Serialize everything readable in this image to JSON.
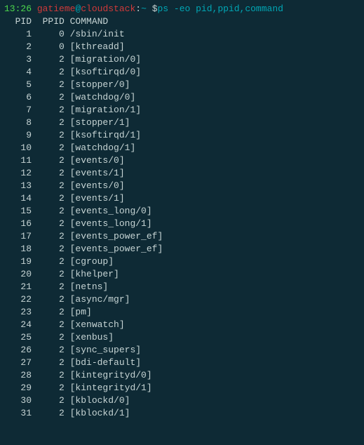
{
  "prompt": {
    "time": "13:26",
    "user": "gatieme",
    "at": "@",
    "host": "cloudstack",
    "colon": ":",
    "path": "~",
    "dollar": " $",
    "command": "ps -eo pid,ppid,command"
  },
  "header": {
    "pid": "  PID",
    "ppid": "  PPID",
    "command": " COMMAND"
  },
  "rows": [
    {
      "pid": "1",
      "ppid": "0",
      "command": "/sbin/init"
    },
    {
      "pid": "2",
      "ppid": "0",
      "command": "[kthreadd]"
    },
    {
      "pid": "3",
      "ppid": "2",
      "command": "[migration/0]"
    },
    {
      "pid": "4",
      "ppid": "2",
      "command": "[ksoftirqd/0]"
    },
    {
      "pid": "5",
      "ppid": "2",
      "command": "[stopper/0]"
    },
    {
      "pid": "6",
      "ppid": "2",
      "command": "[watchdog/0]"
    },
    {
      "pid": "7",
      "ppid": "2",
      "command": "[migration/1]"
    },
    {
      "pid": "8",
      "ppid": "2",
      "command": "[stopper/1]"
    },
    {
      "pid": "9",
      "ppid": "2",
      "command": "[ksoftirqd/1]"
    },
    {
      "pid": "10",
      "ppid": "2",
      "command": "[watchdog/1]"
    },
    {
      "pid": "11",
      "ppid": "2",
      "command": "[events/0]"
    },
    {
      "pid": "12",
      "ppid": "2",
      "command": "[events/1]"
    },
    {
      "pid": "13",
      "ppid": "2",
      "command": "[events/0]"
    },
    {
      "pid": "14",
      "ppid": "2",
      "command": "[events/1]"
    },
    {
      "pid": "15",
      "ppid": "2",
      "command": "[events_long/0]"
    },
    {
      "pid": "16",
      "ppid": "2",
      "command": "[events_long/1]"
    },
    {
      "pid": "17",
      "ppid": "2",
      "command": "[events_power_ef]"
    },
    {
      "pid": "18",
      "ppid": "2",
      "command": "[events_power_ef]"
    },
    {
      "pid": "19",
      "ppid": "2",
      "command": "[cgroup]"
    },
    {
      "pid": "20",
      "ppid": "2",
      "command": "[khelper]"
    },
    {
      "pid": "21",
      "ppid": "2",
      "command": "[netns]"
    },
    {
      "pid": "22",
      "ppid": "2",
      "command": "[async/mgr]"
    },
    {
      "pid": "23",
      "ppid": "2",
      "command": "[pm]"
    },
    {
      "pid": "24",
      "ppid": "2",
      "command": "[xenwatch]"
    },
    {
      "pid": "25",
      "ppid": "2",
      "command": "[xenbus]"
    },
    {
      "pid": "26",
      "ppid": "2",
      "command": "[sync_supers]"
    },
    {
      "pid": "27",
      "ppid": "2",
      "command": "[bdi-default]"
    },
    {
      "pid": "28",
      "ppid": "2",
      "command": "[kintegrityd/0]"
    },
    {
      "pid": "29",
      "ppid": "2",
      "command": "[kintegrityd/1]"
    },
    {
      "pid": "30",
      "ppid": "2",
      "command": "[kblockd/0]"
    },
    {
      "pid": "31",
      "ppid": "2",
      "command": "[kblockd/1]"
    }
  ]
}
